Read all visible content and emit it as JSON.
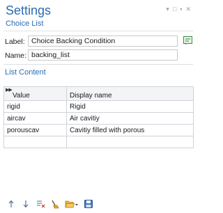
{
  "panel": {
    "title": "Settings",
    "subtitle": "Choice List",
    "window_controls": [
      "▾",
      "□",
      "▪",
      "✕"
    ]
  },
  "form": {
    "label_caption": "Label:",
    "label_value": "Choice Backing Condition",
    "name_caption": "Name:",
    "name_value": "backing_list"
  },
  "list_content": {
    "heading": "List Content",
    "columns": [
      "Value",
      "Display name"
    ],
    "rows": [
      {
        "value": "rigid",
        "display": "Rigid"
      },
      {
        "value": "aircav",
        "display": "Air cavitiy"
      },
      {
        "value": "porouscav",
        "display": "Cavitiy filled with porous"
      },
      {
        "value": "",
        "display": ""
      }
    ]
  },
  "toolbar": {
    "icons": [
      "move-up-icon",
      "move-down-icon",
      "delete-rows-icon",
      "clear-icon",
      "load-from-file-icon",
      "save-to-file-icon"
    ]
  },
  "colors": {
    "accent": "#2b6cb3",
    "border": "#c4c8cd"
  }
}
